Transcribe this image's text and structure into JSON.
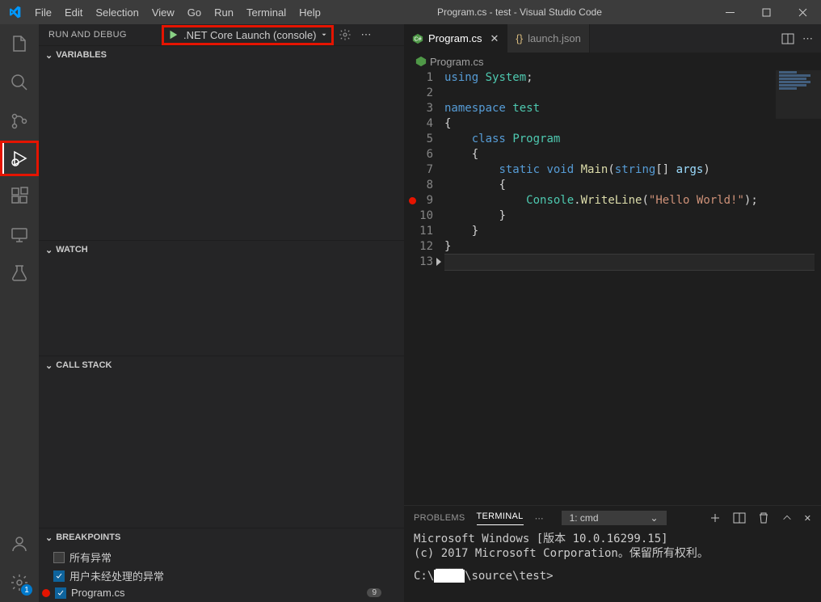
{
  "title": "Program.cs - test - Visual Studio Code",
  "menu": [
    "File",
    "Edit",
    "Selection",
    "View",
    "Go",
    "Run",
    "Terminal",
    "Help"
  ],
  "sidebar": {
    "title": "RUN AND DEBUG"
  },
  "launch": {
    "config": ".NET Core Launch (console)"
  },
  "panes": {
    "variables": "VARIABLES",
    "watch": "WATCH",
    "callstack": "CALL STACK",
    "breakpoints": "BREAKPOINTS"
  },
  "breakpoints": {
    "items": [
      {
        "label": "所有异常",
        "checked": false
      },
      {
        "label": "用户未经处理的异常",
        "checked": true
      },
      {
        "label": "Program.cs",
        "checked": true,
        "dot": true,
        "count": 9
      }
    ]
  },
  "activity": {
    "settings_badge": "1"
  },
  "tabs": [
    {
      "label": "Program.cs",
      "icon": "csharp",
      "active": true
    },
    {
      "label": "launch.json",
      "icon": "json",
      "active": false
    }
  ],
  "breadcrumb": {
    "file": "Program.cs"
  },
  "code": {
    "lines": [
      {
        "n": 1,
        "html": "<span class='tk-kw'>using</span> <span class='tk-type'>System</span><span class='tk-punc'>;</span>"
      },
      {
        "n": 2,
        "html": ""
      },
      {
        "n": 3,
        "html": "<span class='tk-kw'>namespace</span> <span class='tk-type'>test</span>"
      },
      {
        "n": 4,
        "html": "<span class='tk-punc'>{</span>"
      },
      {
        "n": 5,
        "html": "    <span class='tk-kw'>class</span> <span class='tk-type'>Program</span>"
      },
      {
        "n": 6,
        "html": "    <span class='tk-punc'>{</span>"
      },
      {
        "n": 7,
        "html": "        <span class='tk-kw'>static</span> <span class='tk-kw'>void</span> <span class='tk-fn'>Main</span><span class='tk-punc'>(</span><span class='tk-kw'>string</span><span class='tk-punc'>[]</span> <span class='tk-id'>args</span><span class='tk-punc'>)</span>"
      },
      {
        "n": 8,
        "html": "        <span class='tk-punc'>{</span>"
      },
      {
        "n": 9,
        "html": "            <span class='tk-type'>Console</span><span class='tk-punc'>.</span><span class='tk-fn'>WriteLine</span><span class='tk-punc'>(</span><span class='tk-str'>\"Hello World!\"</span><span class='tk-punc'>);</span>",
        "bp": true
      },
      {
        "n": 10,
        "html": "        <span class='tk-punc'>}</span>"
      },
      {
        "n": 11,
        "html": "    <span class='tk-punc'>}</span>"
      },
      {
        "n": 12,
        "html": "<span class='tk-punc'>}</span>"
      },
      {
        "n": 13,
        "html": "",
        "cur": true
      }
    ]
  },
  "panel": {
    "tabs": {
      "problems": "PROBLEMS",
      "terminal": "TERMINAL"
    },
    "terminal_select": "1: cmd",
    "output": {
      "line1": "Microsoft Windows [版本 10.0.16299.15]",
      "line2": "(c) 2017 Microsoft Corporation。保留所有权利。",
      "prompt_prefix": "C:\\",
      "prompt_suffix": "\\source\\test>"
    }
  }
}
